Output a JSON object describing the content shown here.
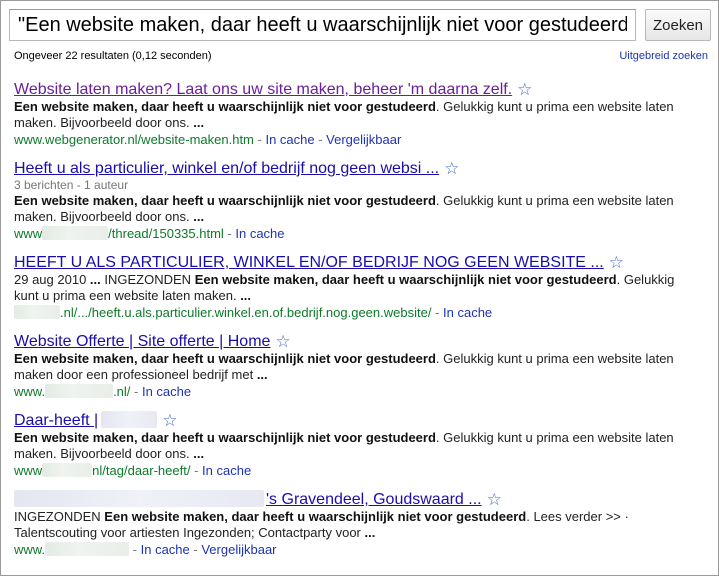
{
  "search": {
    "query": "\"Een website maken, daar heeft u waarschijnlijk niet voor gestudeerd.\"",
    "button_label": "Zoeken"
  },
  "stats_text": "Ongeveer 22 resultaten (0,12 seconden)",
  "advanced_link": "Uitgebreid zoeken",
  "colors": {
    "link": "#1a0dab",
    "visited": "#6b1e9b",
    "url": "#0e7a2a",
    "cache": "#1e33b5"
  },
  "icons": {
    "star": "star-icon"
  },
  "results": [
    {
      "title": "Website laten maken? Laat ons uw site maken, beheer 'm daarna zelf.",
      "snippet_bold": "Een website maken, daar heeft u waarschijnlijk niet voor gestudeerd",
      "snippet_rest": ". Gelukkig kunt u prima een website laten maken. Bijvoorbeeld door ons. ",
      "snippet_end": "...",
      "url": "www.webgenerator.nl/website-maken.htm",
      "cache": "In cache",
      "similar": "Vergelijkbaar"
    },
    {
      "title": "Heeft u als particulier, winkel en/of bedrijf nog geen websi ...",
      "meta": "3 berichten - 1 auteur",
      "snippet_bold": "Een website maken, daar heeft u waarschijnlijk niet voor gestudeerd",
      "snippet_rest": ". Gelukkig kunt u prima een website laten maken. Bijvoorbeeld door ons. ",
      "snippet_end": "...",
      "url_prefix": "www",
      "url_suffix": "/thread/150335.html",
      "cache": "In cache"
    },
    {
      "title": "HEEFT U ALS PARTICULIER, WINKEL EN/OF BEDRIJF NOG GEEN WEBSITE ...",
      "date": "29 aug 2010",
      "snippet_pre": "INGEZONDEN ",
      "snippet_bold": "Een website maken, daar heeft u waarschijnlijk niet voor gestudeerd",
      "snippet_rest": ". Gelukkig kunt u prima een website laten maken. ",
      "snippet_end": "...",
      "url_suffix": ".nl/.../heeft.u.als.particulier.winkel.en.of.bedrijf.nog.geen.website/",
      "cache": "In cache"
    },
    {
      "title": "Website Offerte | Site offerte | Home",
      "snippet_bold": "Een website maken, daar heeft u waarschijnlijk niet voor gestudeerd",
      "snippet_rest": ". Gelukkig kunt u prima een website laten maken door een professioneel bedrijf met ",
      "snippet_end": "...",
      "url_prefix": "www.",
      "url_suffix": ".nl/",
      "cache": "In cache"
    },
    {
      "title": "Daar-heeft |",
      "snippet_bold": "Een website maken, daar heeft u waarschijnlijk niet voor gestudeerd",
      "snippet_rest": ". Gelukkig kunt u prima een website laten maken. Bijvoorbeeld door ons. ",
      "snippet_end": "...",
      "url_prefix": "www",
      "url_suffix": "nl/tag/daar-heeft/",
      "cache": "In cache"
    },
    {
      "title": "'s Gravendeel, Goudswaard ...",
      "snippet_pre": "INGEZONDEN ",
      "snippet_bold": "Een website maken, daar heeft u waarschijnlijk niet voor gestudeerd",
      "snippet_rest": ". Lees verder >> · Talentscouting voor artiesten Ingezonden; Contactparty voor ",
      "snippet_end": "...",
      "url_prefix": "www.",
      "cache": "In cache",
      "similar": "Vergelijkbaar"
    }
  ],
  "ui": {
    "star_glyph": "☆",
    "dash": " - ",
    "ellipsis_bold": "..."
  }
}
